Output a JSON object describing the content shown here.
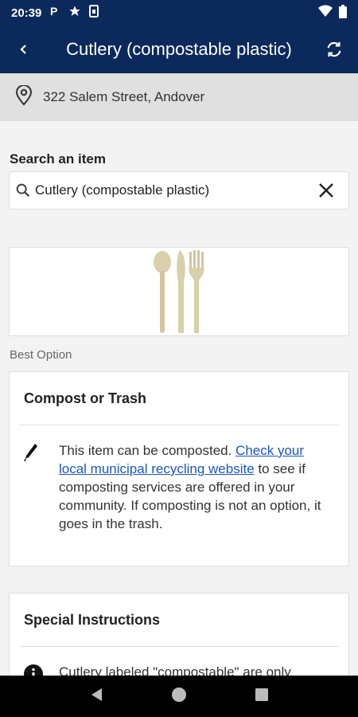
{
  "status_bar": {
    "time": "20:39",
    "icons": [
      "parking-icon",
      "star-icon",
      "sim-icon",
      "wifi-icon",
      "battery-icon"
    ]
  },
  "app_bar": {
    "title": "Cutlery (compostable plastic)",
    "back_icon": "chevron-left-icon",
    "refresh_icon": "refresh-icon"
  },
  "address": {
    "text": "322 Salem Street, Andover"
  },
  "search": {
    "label": "Search an item",
    "value": "Cutlery (compostable plastic)"
  },
  "best_option_label": "Best Option",
  "option_card": {
    "title": "Compost or Trash",
    "text_before": "This item can be composted. ",
    "link_text": "Check your local municipal recycling website",
    "text_after": " to see if composting services are offered in your community. If composting is not an option, it goes in the trash."
  },
  "instructions_card": {
    "title": "Special Instructions",
    "text": "Cutlery labeled \"compostable\" are only"
  },
  "colors": {
    "header": "#0b2a5b",
    "link": "#1a56c8",
    "address_bg": "#e0e0e0"
  }
}
